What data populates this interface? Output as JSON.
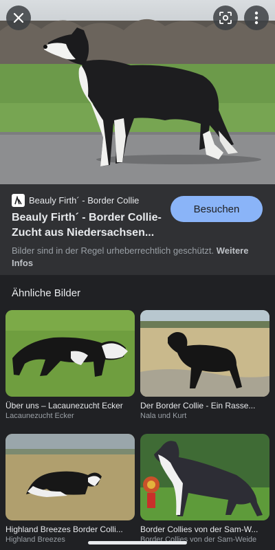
{
  "viewer": {
    "close_icon": "close-icon",
    "lens_icon": "lens-icon",
    "more_icon": "more-vert-icon"
  },
  "result": {
    "source_name": "Beauly Firth´ - Border Collie",
    "title": "Beauly Firth´ - Border Collie-Zucht aus Niedersachsen...",
    "visit_label": "Besuchen",
    "copyright_text": "Bilder sind in der Regel urheberrechtlich geschützt.",
    "more_info_label": "Weitere Infos"
  },
  "related": {
    "heading": "Ähnliche Bilder",
    "items": [
      {
        "title": "Über uns – Lacaunezucht Ecker",
        "site": "Lacaunezucht Ecker"
      },
      {
        "title": "Der Border Collie - Ein Rasse...",
        "site": "Nala und Kurt"
      },
      {
        "title": "Highland Breezes Border Colli...",
        "site": "Highland Breezes"
      },
      {
        "title": "Border Collies von der Sam-W...",
        "site": "Border Collies von der Sam-Weide"
      }
    ]
  },
  "colors": {
    "background": "#202124",
    "panel": "#303134",
    "accent": "#8ab4f8"
  }
}
